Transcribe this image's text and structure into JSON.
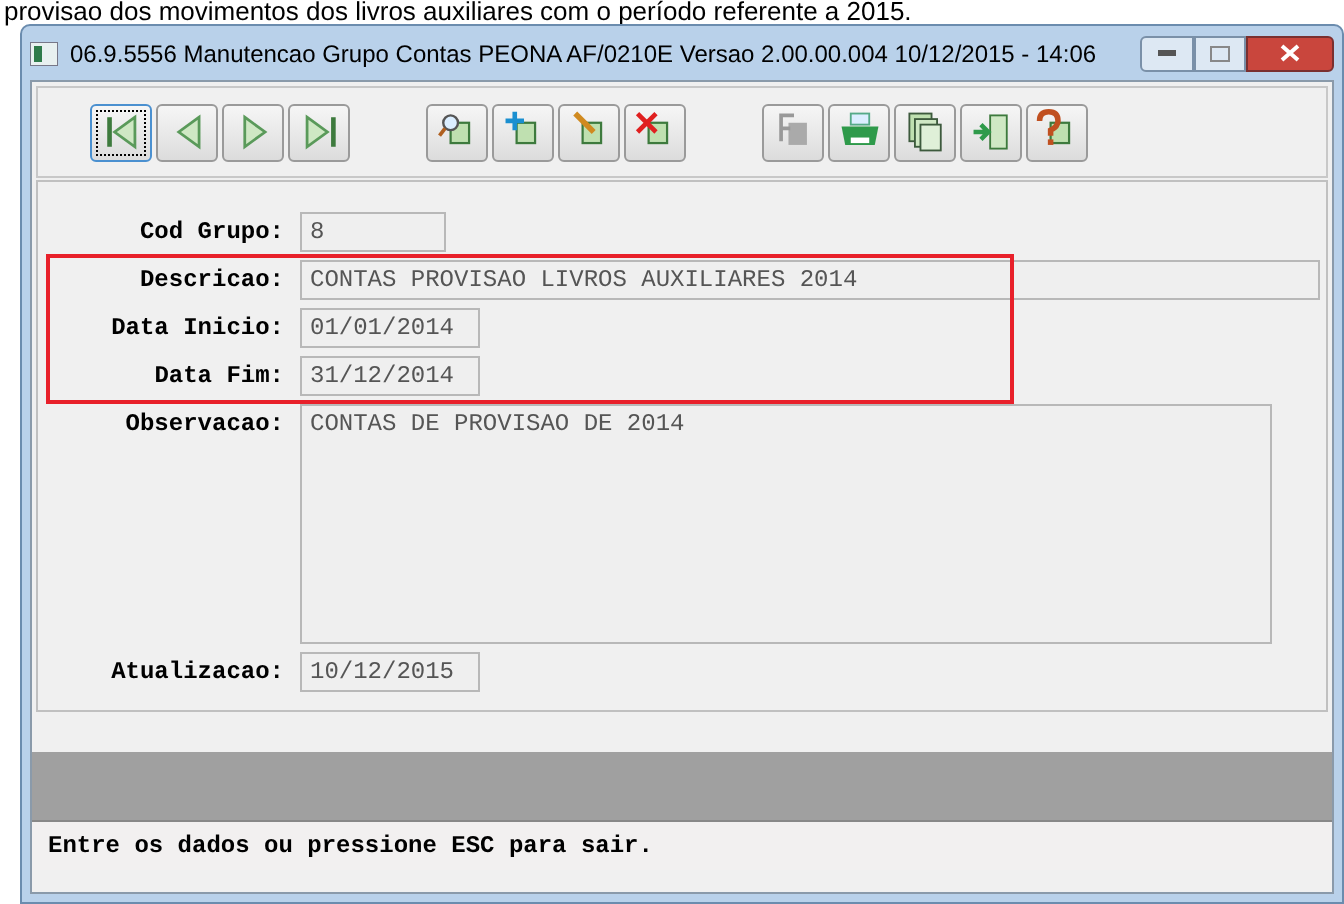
{
  "caption": "provisao dos movimentos dos livros auxiliares com o período referente a 2015.",
  "window": {
    "title": "06.9.5556 Manutencao Grupo Contas PEONA AF/0210E Versao 2.00.00.004 10/12/2015 - 14:06"
  },
  "fields": [
    {
      "label": "Cod Grupo:",
      "value": "8",
      "kind": "short"
    },
    {
      "label": "Descricao:",
      "value": "CONTAS PROVISAO LIVROS AUXILIARES 2014",
      "kind": "wide"
    },
    {
      "label": "Data Inicio:",
      "value": "01/01/2014",
      "kind": "date"
    },
    {
      "label": "Data Fim:",
      "value": "31/12/2014",
      "kind": "date"
    },
    {
      "label": "Observacao:",
      "value": "CONTAS DE PROVISAO DE 2014",
      "kind": "memo"
    },
    {
      "label": "Atualizacao:",
      "value": "10/12/2015",
      "kind": "date"
    }
  ],
  "status_bar": "Entre os dados ou pressione ESC para sair."
}
